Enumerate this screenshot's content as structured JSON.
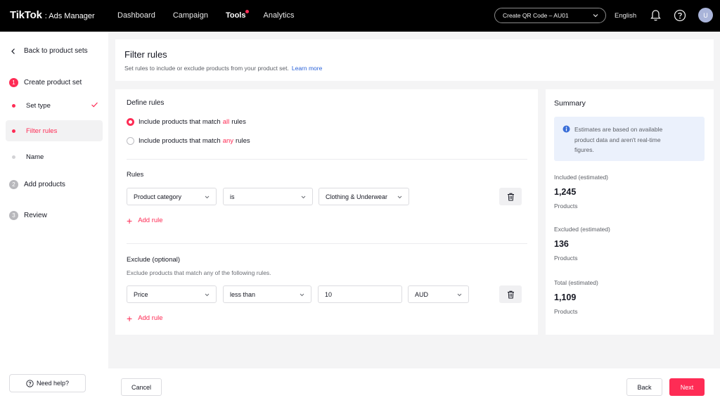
{
  "app": {
    "logo_main": "TikTok",
    "logo_sub": ": Ads Manager"
  },
  "nav": {
    "items": [
      "Dashboard",
      "Campaign",
      "Tools",
      "Analytics"
    ],
    "notification_dot_item": "Tools"
  },
  "account": {
    "selector": "Create QR Code – AU01",
    "language": "English",
    "avatar_initial": "U"
  },
  "sidebar": {
    "back_label": "Back to product sets",
    "steps": [
      {
        "number": "1",
        "label": "Create product set"
      },
      {
        "number": "2",
        "label": "Add products"
      },
      {
        "number": "3",
        "label": "Review"
      }
    ],
    "substeps": [
      {
        "label": "Set type"
      },
      {
        "label": "Filter rules"
      },
      {
        "label": "Name"
      }
    ],
    "need_help": "Need help?"
  },
  "header": {
    "title": "Filter rules",
    "subtitle": "Set rules to include or exclude products from your product set.",
    "learn_more": "Learn more"
  },
  "define_rules": {
    "title": "Define rules",
    "option_all": {
      "prefix": "Include products that match",
      "highlight": "all",
      "suffix": "rules"
    },
    "option_any": {
      "prefix": "Include products that match",
      "highlight": "any",
      "suffix": "rules"
    }
  },
  "rules": {
    "title": "Rules",
    "row": {
      "field": "Product category",
      "operator": "is",
      "value": "Clothing & Underwear"
    },
    "add_rule": "Add rule"
  },
  "exclude": {
    "title": "Exclude (optional)",
    "hint": "Exclude products that match any of the following rules.",
    "row": {
      "field": "Price",
      "operator": "less than",
      "value": "10",
      "currency": "AUD"
    },
    "add_rule": "Add rule"
  },
  "summary": {
    "title": "Summary",
    "notice": "Estimates are based on available product data and aren't real-time figures.",
    "metrics": [
      {
        "label": "Included (estimated)",
        "value": "1,245",
        "unit": "Products"
      },
      {
        "label": "Excluded (estimated)",
        "value": "136",
        "unit": "Products"
      },
      {
        "label": "Total (estimated)",
        "value": "1,109",
        "unit": "Products"
      }
    ]
  },
  "footer": {
    "cancel": "Cancel",
    "back": "Back",
    "next": "Next"
  },
  "colors": {
    "accent": "#fe2c55",
    "link": "#2b63d9",
    "topbar": "#000000"
  }
}
